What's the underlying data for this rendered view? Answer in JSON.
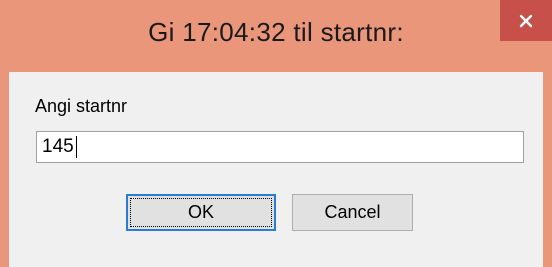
{
  "dialog": {
    "title": "Gi 17:04:32 til startnr:",
    "prompt_label": "Angi startnr",
    "input_value": "145",
    "ok_label": "OK",
    "cancel_label": "Cancel"
  },
  "icons": {
    "close": "close-icon"
  },
  "colors": {
    "titlebar": "#e9967a",
    "close_button": "#c7504a",
    "client_background": "#f0f0f0",
    "button_face": "#e1e1e1",
    "focus_border": "#2b7ad6"
  }
}
